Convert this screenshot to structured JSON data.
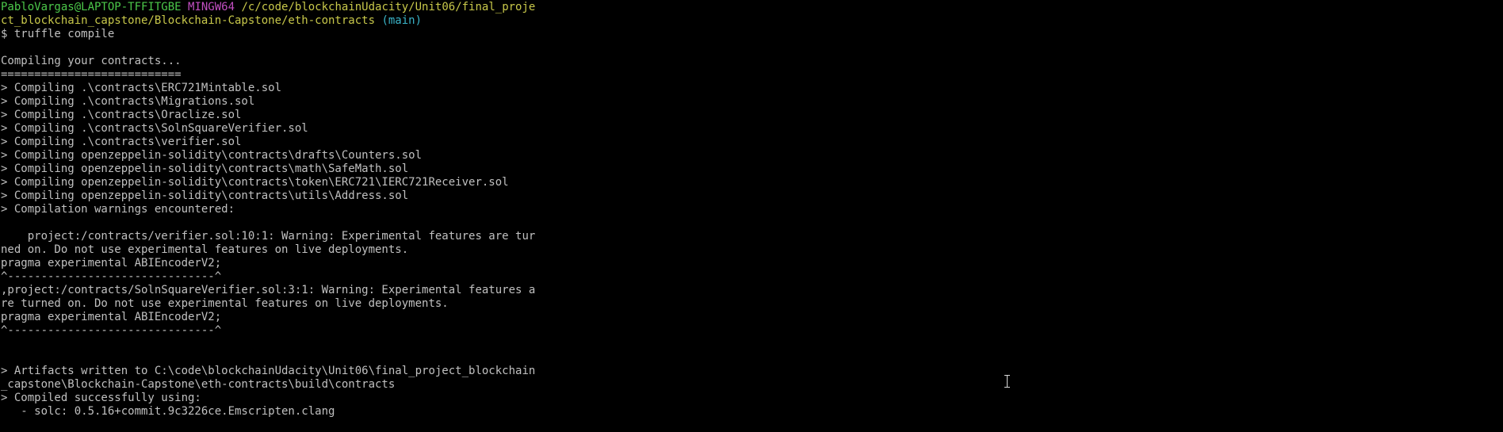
{
  "prompt": {
    "user_host": "PabloVargas@LAPTOP-TFFITGBE",
    "shell": "MINGW64",
    "path_line1": "/c/code/blockchainUdacity/Unit06/final_proje",
    "path_line2": "ct_blockchain_capstone/Blockchain-Capstone/eth-contracts",
    "branch": "(main)",
    "command": "$ truffle compile"
  },
  "output": [
    "",
    "Compiling your contracts...",
    "===========================",
    "> Compiling .\\contracts\\ERC721Mintable.sol",
    "> Compiling .\\contracts\\Migrations.sol",
    "> Compiling .\\contracts\\Oraclize.sol",
    "> Compiling .\\contracts\\SolnSquareVerifier.sol",
    "> Compiling .\\contracts\\verifier.sol",
    "> Compiling openzeppelin-solidity\\contracts\\drafts\\Counters.sol",
    "> Compiling openzeppelin-solidity\\contracts\\math\\SafeMath.sol",
    "> Compiling openzeppelin-solidity\\contracts\\token\\ERC721\\IERC721Receiver.sol",
    "> Compiling openzeppelin-solidity\\contracts\\utils\\Address.sol",
    "> Compilation warnings encountered:",
    "",
    "    project:/contracts/verifier.sol:10:1: Warning: Experimental features are tur",
    "ned on. Do not use experimental features on live deployments.",
    "pragma experimental ABIEncoderV2;",
    "^-------------------------------^",
    ",project:/contracts/SolnSquareVerifier.sol:3:1: Warning: Experimental features a",
    "re turned on. Do not use experimental features on live deployments.",
    "pragma experimental ABIEncoderV2;",
    "^-------------------------------^",
    "",
    "",
    "> Artifacts written to C:\\code\\blockchainUdacity\\Unit06\\final_project_blockchain",
    "_capstone\\Blockchain-Capstone\\eth-contracts\\build\\contracts",
    "> Compiled successfully using:",
    "   - solc: 0.5.16+commit.9c3226ce.Emscripten.clang"
  ],
  "colors": {
    "background": "#000000",
    "text": "#c0c0c0",
    "user_host": "#4cc84a",
    "shell": "#c24fc2",
    "path": "#c8c84a",
    "branch": "#3ab4c8"
  },
  "icons": {
    "mouse_cursor": "i-beam-cursor-icon"
  }
}
